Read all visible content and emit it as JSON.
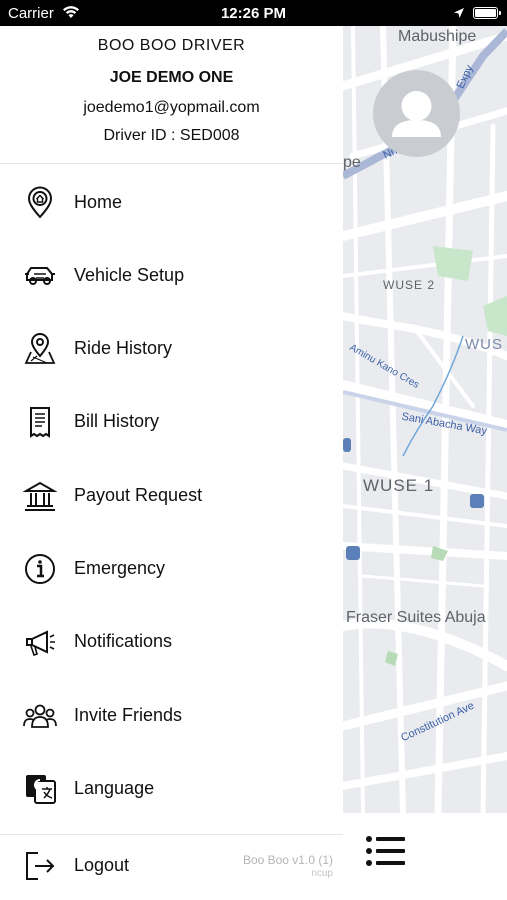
{
  "status_bar": {
    "carrier": "Carrier",
    "time": "12:26 PM"
  },
  "drawer": {
    "app_name": "BOO BOO DRIVER",
    "user_name": "JOE DEMO ONE",
    "email": "joedemo1@yopmail.com",
    "driver_id": "Driver ID : SED008",
    "items": [
      {
        "label": "Home",
        "icon": "home-pin-icon"
      },
      {
        "label": "Vehicle Setup",
        "icon": "vehicle-icon"
      },
      {
        "label": "Ride History",
        "icon": "map-pin-icon"
      },
      {
        "label": "Bill History",
        "icon": "receipt-icon"
      },
      {
        "label": "Payout Request",
        "icon": "bank-icon"
      },
      {
        "label": "Emergency",
        "icon": "info-icon"
      },
      {
        "label": "Notifications",
        "icon": "megaphone-icon"
      },
      {
        "label": "Invite Friends",
        "icon": "group-icon"
      },
      {
        "label": "Language",
        "icon": "translate-icon"
      }
    ],
    "logout_label": "Logout",
    "version": "Boo Boo v1.0 (1)",
    "build": "ncup"
  },
  "map": {
    "labels": {
      "mabushipe": "Mabushipe",
      "pe": "pe",
      "wuse2": "WUSE 2",
      "wus": "WUS",
      "aminu": "Aminu Kano Cres",
      "sani": "Sani Abacha Way",
      "wuse1": "WUSE 1",
      "fraser": "Fraser Suites Abuja",
      "constitution": "Constitution Ave",
      "expy": "Expy",
      "nna": "Nna"
    }
  }
}
